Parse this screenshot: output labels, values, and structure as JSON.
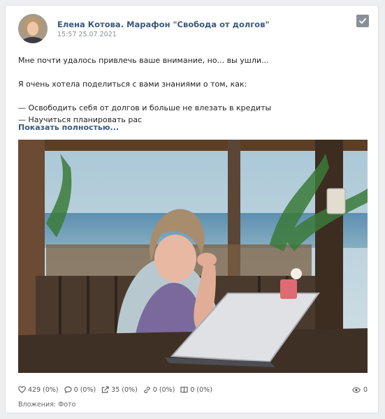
{
  "post": {
    "author": "Елена Котова. Марафон \"Свобода от долгов\"",
    "timestamp": "15:57 25.07.2021",
    "text_lines": [
      "Мне почти удалось привлечь ваше внимание, но... вы ушли...",
      "",
      "Я очень хотела поделиться с вами знаниями о том, как:",
      "",
      "— Освободить себя от долгов и больше не влезать в кредиты",
      "— Научиться планировать рас"
    ],
    "show_more": "Показать полностью..."
  },
  "stats": {
    "likes": "429 (0%)",
    "comments": "0 (0%)",
    "shares": "35 (0%)",
    "links": "0 (0%)",
    "saves": "0 (0%)",
    "views": "0"
  },
  "attachments": "Вложения: Фото",
  "colors": {
    "link": "#3a587c",
    "muted": "#8b8f96",
    "background": "#edeef0"
  },
  "icons": [
    "check-icon",
    "heart-icon",
    "comment-icon",
    "share-icon",
    "link-icon",
    "book-icon",
    "eye-icon"
  ]
}
